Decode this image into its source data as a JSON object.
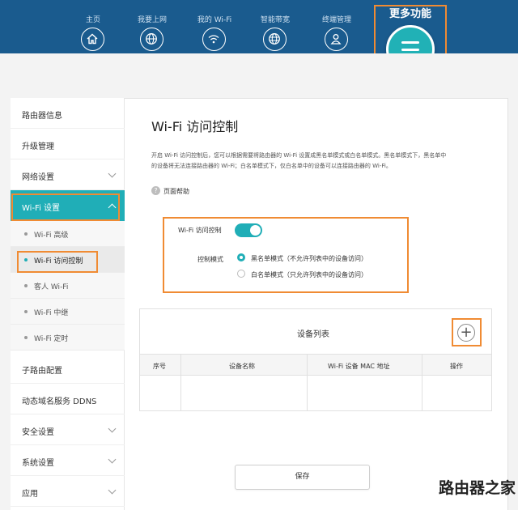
{
  "nav": {
    "items": [
      {
        "label": "主页",
        "icon": "home-icon"
      },
      {
        "label": "我要上网",
        "icon": "globe-icon"
      },
      {
        "label": "我的 Wi-Fi",
        "icon": "wifi-icon"
      },
      {
        "label": "智能带宽",
        "icon": "bandwidth-globe-icon"
      },
      {
        "label": "终端管理",
        "icon": "user-icon"
      }
    ],
    "more_label": "更多功能",
    "more_icon": "menu-icon"
  },
  "sidebar": {
    "items": [
      {
        "label": "路由器信息"
      },
      {
        "label": "升级管理"
      },
      {
        "label": "网络设置"
      },
      {
        "label": "Wi-Fi 设置"
      },
      {
        "label": "子路由配置"
      },
      {
        "label": "动态域名服务 DDNS"
      },
      {
        "label": "安全设置"
      },
      {
        "label": "系统设置"
      },
      {
        "label": "应用"
      }
    ],
    "sub_items": [
      {
        "label": "Wi-Fi 高级"
      },
      {
        "label": "Wi-Fi 访问控制"
      },
      {
        "label": "客人 Wi-Fi"
      },
      {
        "label": "Wi-Fi 中继"
      },
      {
        "label": "Wi-Fi 定时"
      }
    ]
  },
  "content": {
    "title": "Wi-Fi 访问控制",
    "desc_line1": "开启 Wi-Fi 访问控制后，您可以根据需要将路由器的 Wi-Fi 设置成黑名单模式或白名单模式。黑名单模式下，黑名单中",
    "desc_line2": "的设备将无法连接路由器的 Wi-Fi；白名单模式下，仅白名单中的设备可以连接路由器的 Wi-Fi。",
    "help_icon": "?",
    "help_label": "页面帮助",
    "access_control_label": "Wi-Fi 访问控制",
    "access_control_enabled": true,
    "mode_label": "控制模式",
    "mode_blacklist": "黑名单模式（不允许列表中的设备访问）",
    "mode_whitelist": "白名单模式（只允许列表中的设备访问）",
    "selected_mode": "blacklist"
  },
  "device_list": {
    "title": "设备列表",
    "add_symbol": "+",
    "columns": [
      "序号",
      "设备名称",
      "Wi-Fi 设备 MAC 地址",
      "操作"
    ],
    "rows": []
  },
  "save_label": "保存",
  "watermark": "路由器之家",
  "colors": {
    "nav_bg": "#1a5b8e",
    "accent": "#20aeb7",
    "highlight": "#f08b33"
  }
}
